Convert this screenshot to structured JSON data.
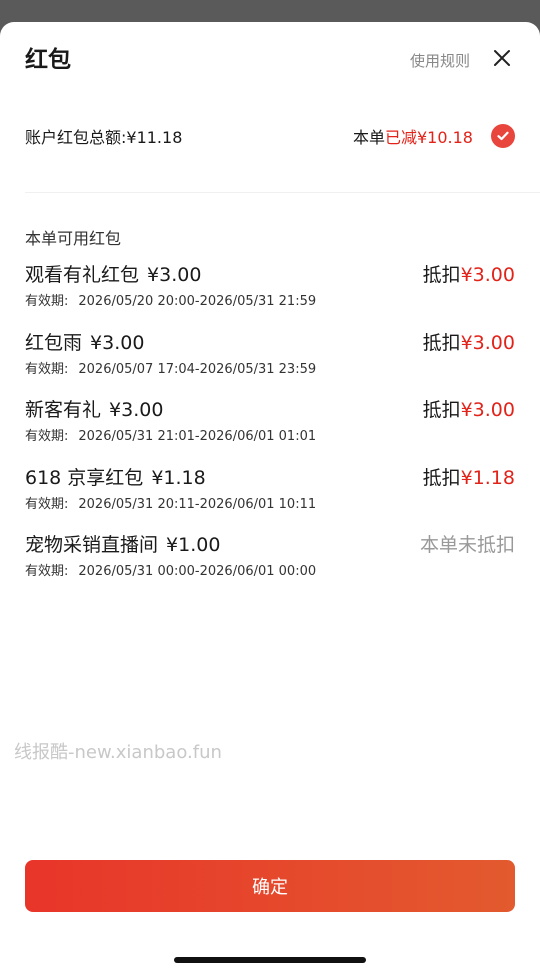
{
  "header": {
    "title": "红包",
    "rules_link": "使用规则"
  },
  "summary": {
    "total_label": "账户红包总额:¥11.18",
    "this_order": "本单",
    "deducted": "已减¥10.18"
  },
  "section_label": "本单可用红包",
  "items": [
    {
      "name": "观看有礼红包",
      "amount": "¥3.00",
      "validity_label": "有效期:",
      "validity": "2026/05/20 20:00-2026/05/31 21:59",
      "deduct_label": "抵扣",
      "deduct_value": "¥3.00"
    },
    {
      "name": "红包雨",
      "amount": "¥3.00",
      "validity_label": "有效期:",
      "validity": "2026/05/07 17:04-2026/05/31 23:59",
      "deduct_label": "抵扣",
      "deduct_value": "¥3.00"
    },
    {
      "name": "新客有礼",
      "amount": "¥3.00",
      "validity_label": "有效期:",
      "validity": "2026/05/31 21:01-2026/06/01 01:01",
      "deduct_label": "抵扣",
      "deduct_value": "¥3.00"
    },
    {
      "name": "618 京享红包",
      "amount": "¥1.18",
      "validity_label": "有效期:",
      "validity": "2026/05/31 20:11-2026/06/01 10:11",
      "deduct_label": "抵扣",
      "deduct_value": "¥1.18"
    },
    {
      "name": "宠物采销直播间",
      "amount": "¥1.00",
      "validity_label": "有效期:",
      "validity": "2026/05/31 00:00-2026/06/01 00:00",
      "deduct_status": "本单未抵扣"
    }
  ],
  "watermark": "线报酷-new.xianbao.fun",
  "confirm_button": "确定",
  "colors": {
    "accent_red": "#e2231a",
    "check_red": "#e8453c",
    "button_gradient_start": "#e8352a",
    "button_gradient_end": "#e35a2e",
    "muted_text": "#999999"
  },
  "icons": {
    "close": "close-icon",
    "selected": "check-circle-icon"
  }
}
